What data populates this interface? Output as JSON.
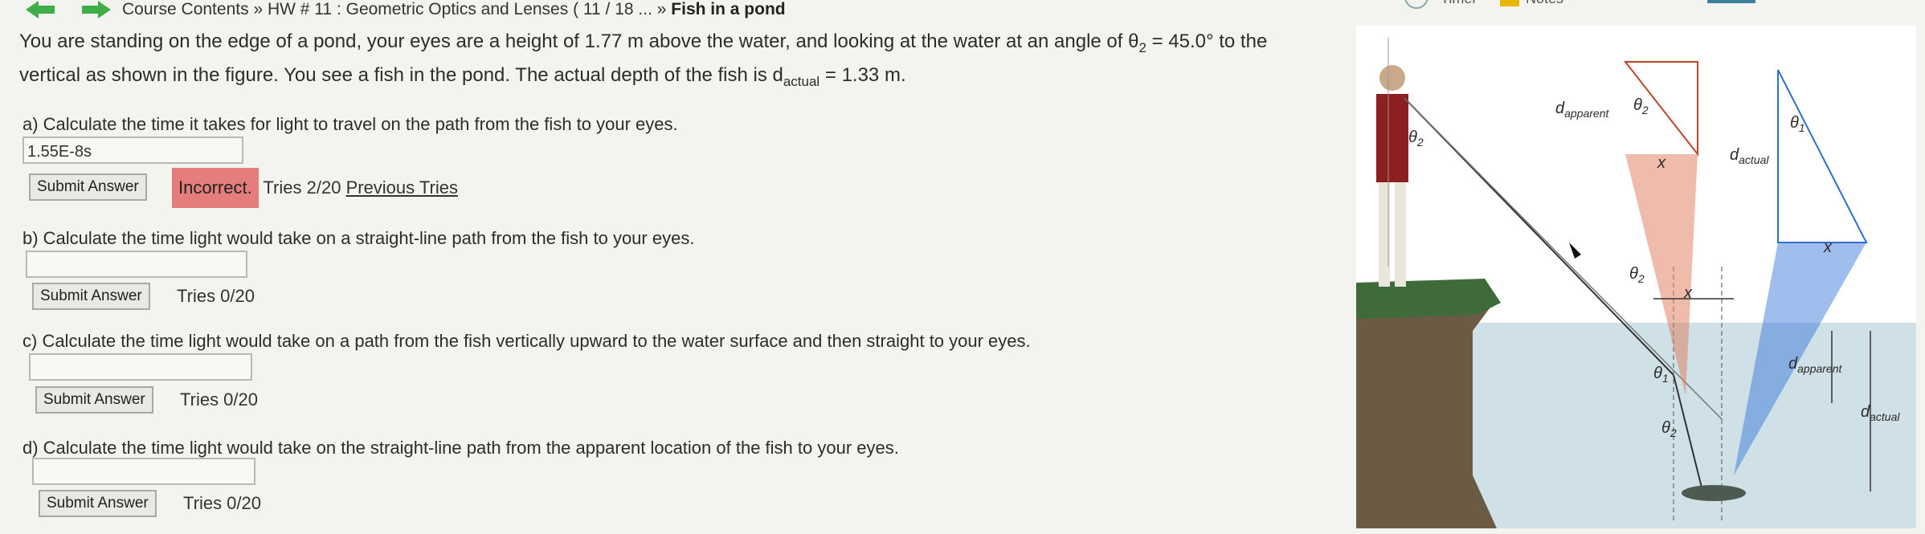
{
  "breadcrumb": {
    "course": "Course Contents",
    "sep1": "»",
    "hw": "HW # 11 : Geometric Optics and Lenses ( 11 / 18 ...",
    "sep2": "»",
    "current": "Fish in a pond"
  },
  "toolbar": {
    "timer": "Timer",
    "notes": "Notes"
  },
  "question": {
    "line1_pre": "You are standing on the edge of a pond, your eyes are a height of 1.77 m above the water, and looking at the water at an angle of θ",
    "line1_sub": "2",
    "line1_post": " = 45.0° to the",
    "line2_pre": "vertical as shown in the figure. You see a fish in the pond. The actual depth of the fish is d",
    "line2_sub": "actual",
    "line2_post": " = 1.33 m."
  },
  "parts": [
    {
      "label": "a) Calculate the time it takes for light to travel on the path from the fish to your eyes.",
      "value": "1.55E-8s",
      "submit": "Submit Answer",
      "status": "Incorrect.",
      "tries": "Tries 2/20",
      "previous": "Previous Tries"
    },
    {
      "label": "b) Calculate the time light would take on a straight-line path from the fish to your eyes.",
      "value": "",
      "submit": "Submit Answer",
      "tries": "Tries 0/20"
    },
    {
      "label": "c) Calculate the time light would take on a path from the fish vertically upward to the water surface and then straight to your eyes.",
      "value": "",
      "submit": "Submit Answer",
      "tries": "Tries 0/20"
    },
    {
      "label": "d) Calculate the time light would take on the straight-line path from the apparent location of the fish to your eyes.",
      "value": "",
      "submit": "Submit Answer",
      "tries": "Tries 0/20"
    }
  ],
  "figure": {
    "d_apparent_main": "d",
    "d_apparent_sub": "apparent",
    "d_actual_main": "d",
    "d_actual_sub": "actual",
    "theta1": "θ",
    "theta1_sub": "1",
    "theta2": "θ",
    "theta2_sub": "2",
    "x": "x"
  },
  "colors": {
    "incorrect": "#e57d7c",
    "nav_arrow": "#3fae49",
    "water": "#cfe0e6",
    "triangle_blue": "#2a6fd6",
    "triangle_red": "#e07a5a"
  },
  "icons": {
    "back": "back-arrow-icon",
    "forward": "forward-arrow-icon"
  }
}
